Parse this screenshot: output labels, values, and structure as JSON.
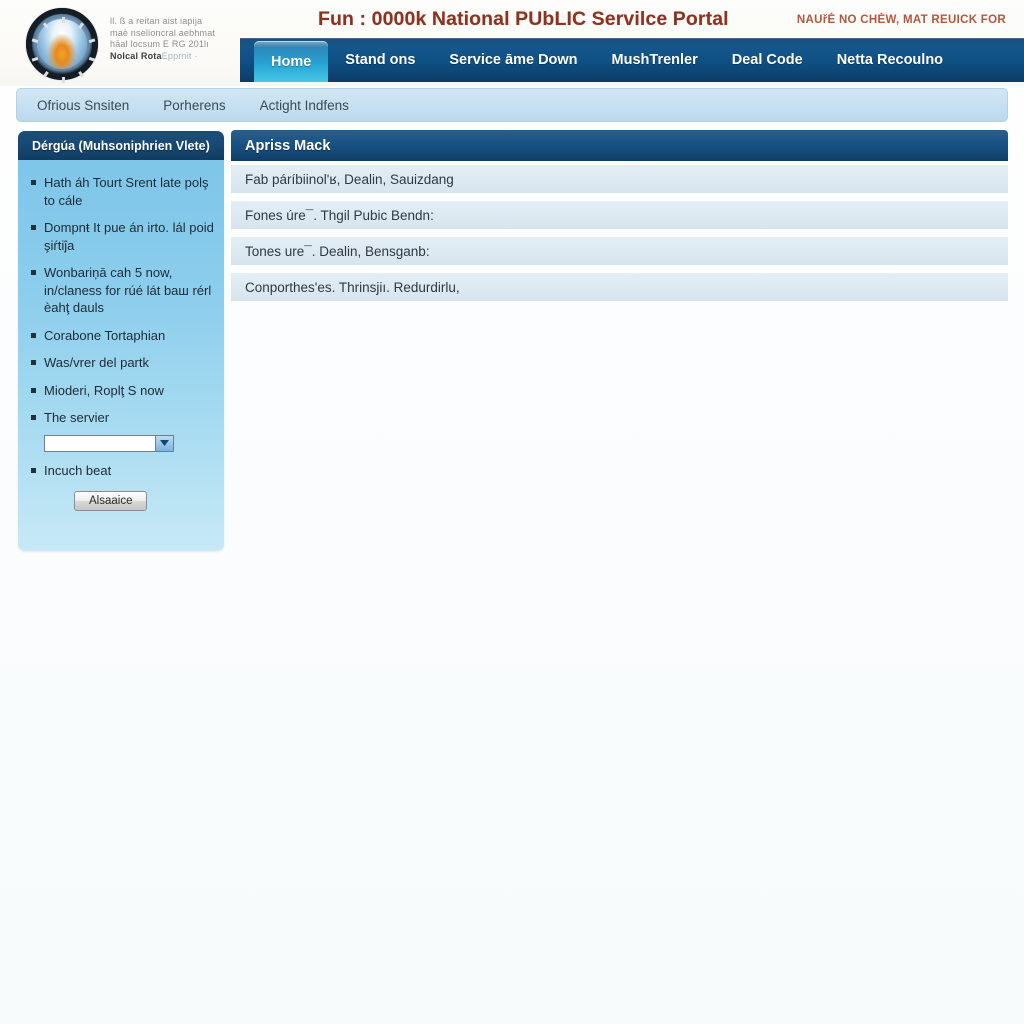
{
  "header": {
    "org_lines": [
      "ll. ß a reitan aist iapija",
      "maè nselioncral aebhmat",
      "hāal locsum E RG   201lı",
      "Nolcal Rota"
    ],
    "org_line_link": "Epprnit  ·",
    "portal_title": "Fun : 0000k National PUbLIC Servilce Portal",
    "marquee_note": "NAUřĖ NO CHĖW, MAT REUICK FOR",
    "logo_alt": "national-emblem"
  },
  "nav": {
    "items": [
      {
        "label": "Home",
        "active": true
      },
      {
        "label": "Stand ons",
        "active": false
      },
      {
        "label": "Service āme Down",
        "active": false
      },
      {
        "label": "MushTrenler",
        "active": false
      },
      {
        "label": "Deal Code",
        "active": false
      },
      {
        "label": "Netta Recoulno",
        "active": false
      }
    ]
  },
  "breadcrumb": {
    "items": [
      "Ofrious Snsiten",
      "Porherens",
      "Actight Indfens"
    ]
  },
  "sidebar": {
    "title": "Dérgúa (Muhsoniphrien Vlete)",
    "items": [
      "Hath áh Tourt Srent late polş to cále",
      "Dompnŧ It pue án irto. lál poid şiŕtiĵa",
      "Wonbariņā cah 5 now, in/claness for rúé  lát baш rérl èahţ dauls",
      "Corabone Tortaphian",
      "Was/vrer del partk",
      "Mioderi, Roplţ S now",
      "The servier"
    ],
    "select_value": "",
    "item_after_select": "Incuch beat",
    "apply_label": "Alsaaice"
  },
  "main": {
    "panel_title": "Apriss Mack",
    "rows": [
      "Fab páríbiinolʹʁ, Dealin, Sauizdang",
      "Fones úre¯. Thgil Pubic Bendn:",
      "Tones ure¯. Dealin, Bensganb:",
      "Conporthesʹes. Thrinsjiı. Redurdirlu,"
    ]
  },
  "colors": {
    "brand_dark_blue": "#123c61",
    "nav_blue": "#0f4f83",
    "active_tab_cyan": "#25a4d4",
    "title_red": "#8c3320",
    "note_red": "#b4563c",
    "sidebar_blue": "#8bcdec",
    "row_bg": "#dde9f1",
    "breadcrumb_bg": "#c5e0f1",
    "page_bg": "#fafcfd"
  }
}
